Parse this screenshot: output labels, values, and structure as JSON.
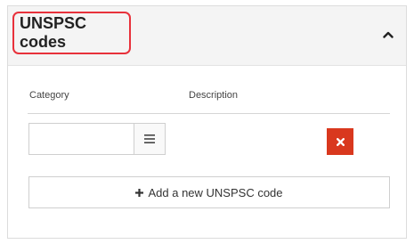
{
  "panel": {
    "title": "UNSPSC codes",
    "collapse_icon": "chevron-up-icon"
  },
  "table": {
    "headers": [
      "Category",
      "Description"
    ],
    "rows": [
      {
        "category_value": "",
        "description": "",
        "list_icon": "list-icon",
        "remove_icon": "remove-icon"
      }
    ]
  },
  "add_button": {
    "icon": "plus-icon",
    "label": "Add a new UNSPSC code"
  },
  "colors": {
    "highlight_border": "#e8313b",
    "remove_button": "#d9381e",
    "header_bg": "#f4f4f4"
  }
}
